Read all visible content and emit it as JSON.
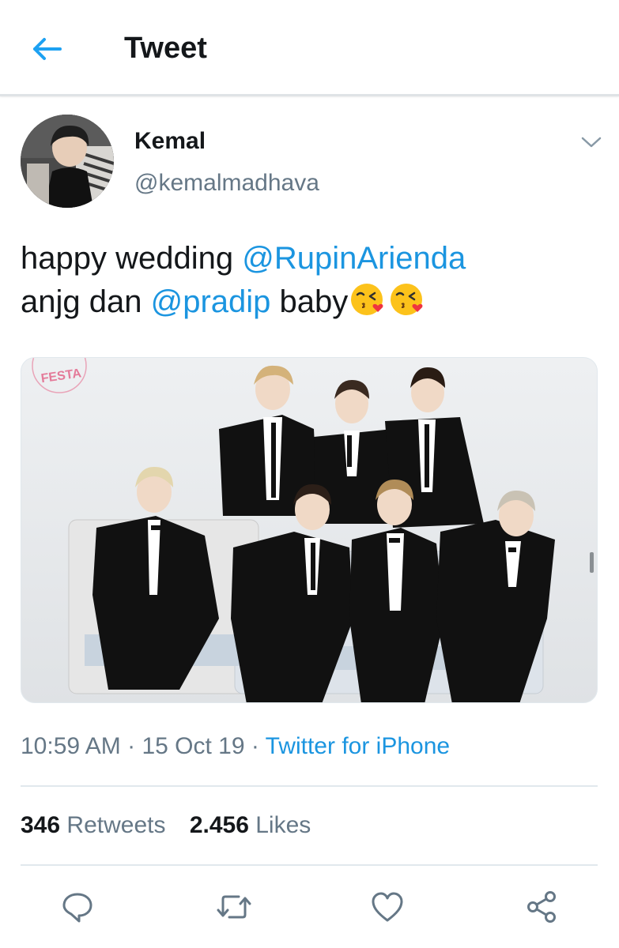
{
  "header": {
    "title": "Tweet",
    "back_icon": "back-arrow-icon",
    "accent": "#1da1f2"
  },
  "author": {
    "name": "Kemal",
    "handle": "@kemalmadhava"
  },
  "tweet": {
    "text_1": "happy wedding ",
    "mention_1": "@RupinArienda",
    "text_2": "anjg dan ",
    "mention_2": "@pradip",
    "text_3": " baby",
    "emoji": "face-throwing-a-kiss-emoji"
  },
  "media": {
    "watermark": "FESTA",
    "type": "photo"
  },
  "meta": {
    "time": "10:59 AM",
    "sep_1": " · ",
    "date": "15 Oct 19",
    "sep_2": " · ",
    "source": "Twitter for iPhone"
  },
  "stats": {
    "retweets_count": "346",
    "retweets_label": "Retweets",
    "likes_count": "2.456",
    "likes_label": "Likes"
  },
  "actions": [
    "reply-icon",
    "retweet-icon",
    "like-icon",
    "share-icon"
  ],
  "colors": {
    "link": "#1b95e0",
    "text": "#14171a",
    "secondary": "#657786",
    "divider": "#e1e8ed"
  }
}
